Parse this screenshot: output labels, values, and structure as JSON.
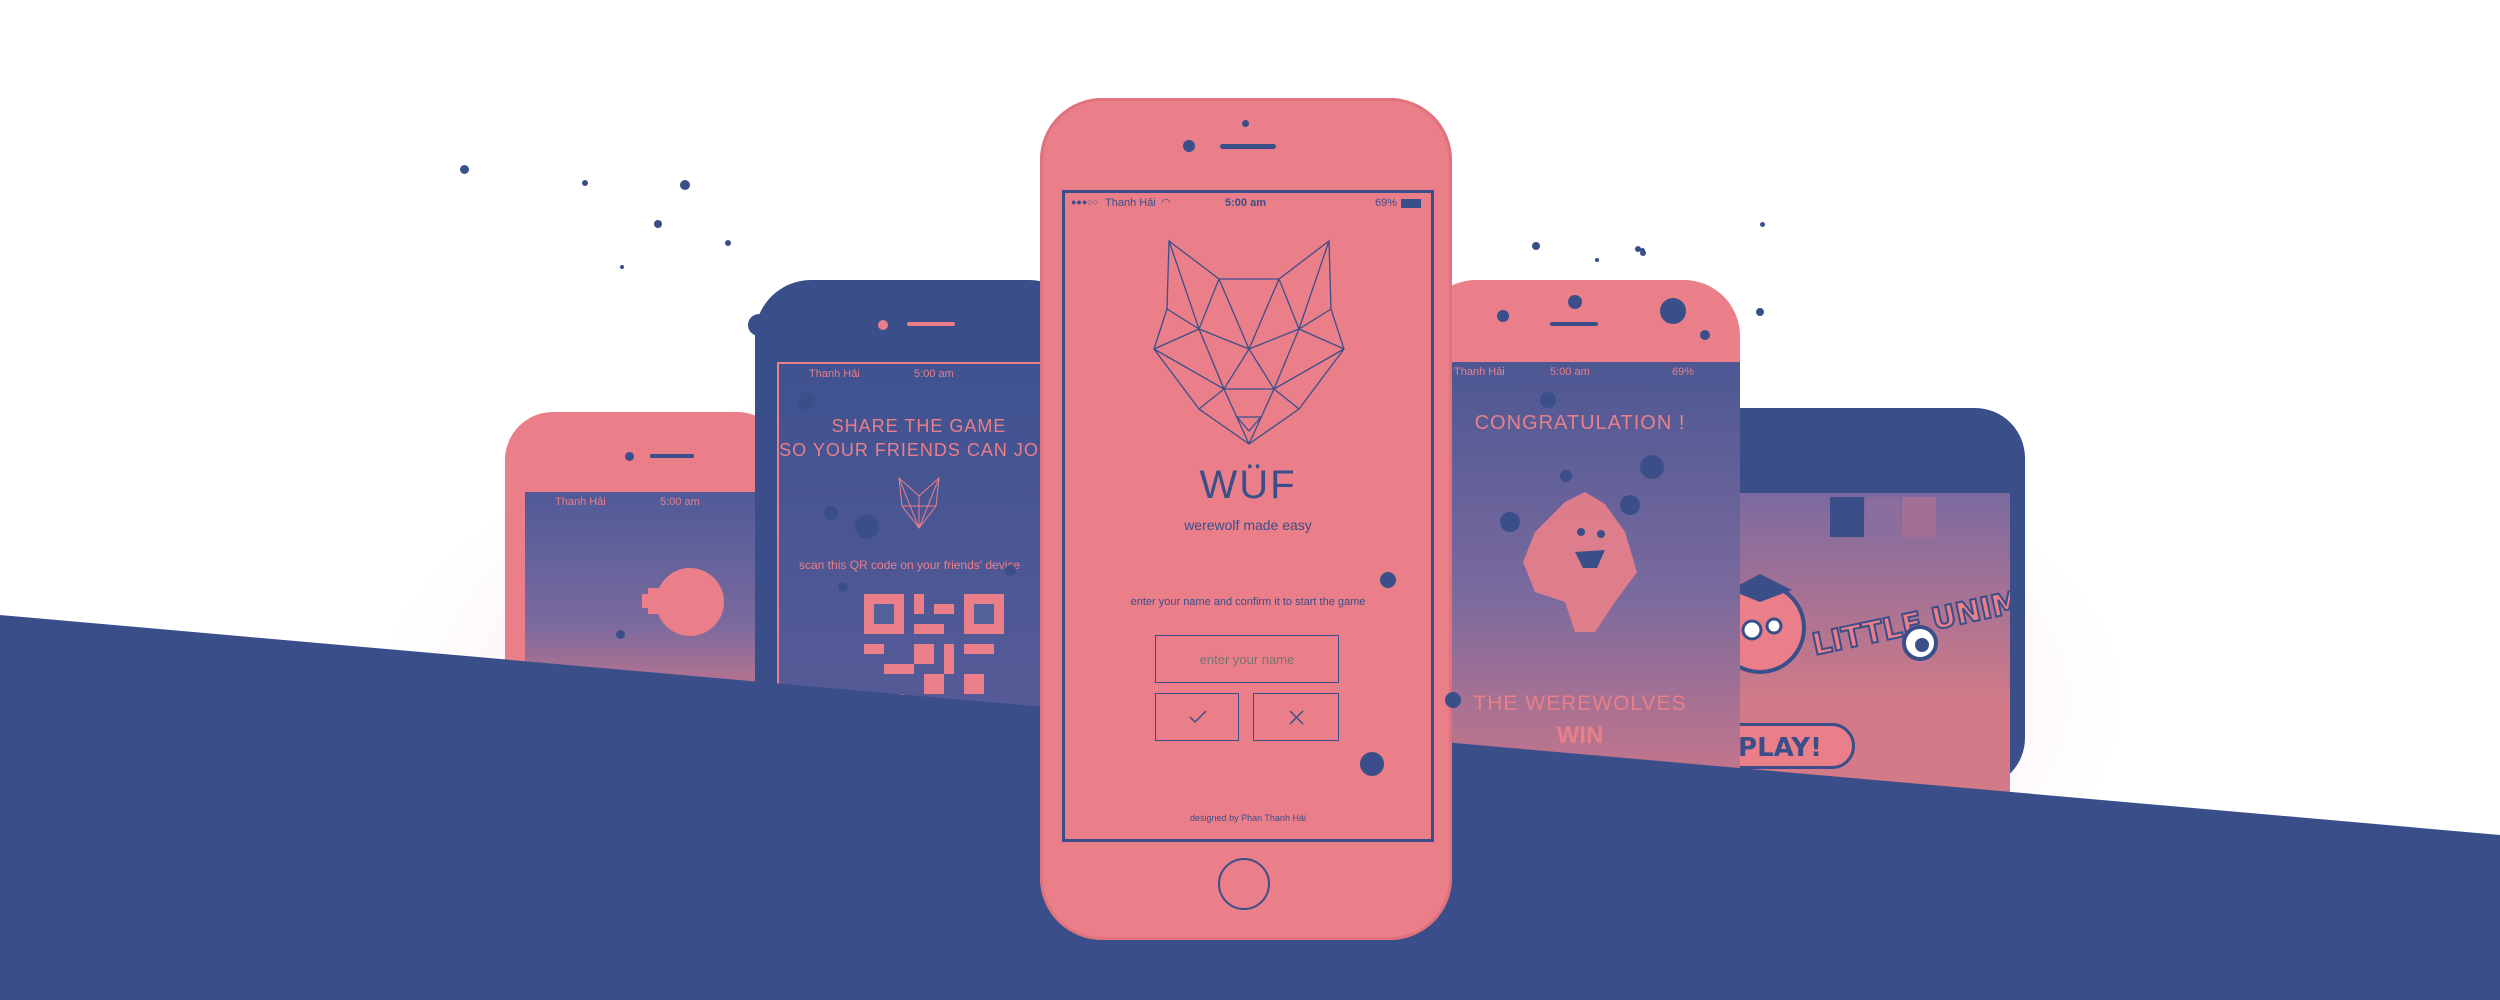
{
  "palette": {
    "navy": "#3a4f8a",
    "coral": "#ea7f89",
    "white": "#ffffff"
  },
  "main_phone": {
    "status": {
      "carrier": "Thanh Hải",
      "time": "5:00 am",
      "battery": "69%"
    },
    "logo_icon": "wolf-geometric-icon",
    "app_name": "WÜF",
    "tagline": "werewolf made easy",
    "instruction": "enter your name and confirm it to start the game",
    "name_input_placeholder": "enter your name",
    "confirm_icon": "checkmark-icon",
    "cancel_icon": "close-icon",
    "footer": "designed by Phan Thanh Hải"
  },
  "share_phone": {
    "status": {
      "carrier": "Thanh Hải",
      "time": "5:00 am"
    },
    "title_line1": "SHARE THE GAME",
    "title_line2": "SO YOUR FRIENDS CAN JOIN",
    "instruction": "scan this QR code on your friends' device"
  },
  "left_phone": {
    "status": {
      "carrier": "Thanh Hải",
      "time": "5:00 am"
    }
  },
  "result_phone": {
    "status": {
      "carrier": "Thanh Hải",
      "time": "5:00 am",
      "battery": "69%"
    },
    "title": "CONGRATULATION !",
    "result_line1": "THE WEREWOLVES",
    "result_line2": "WIN"
  },
  "game_phone": {
    "logo_text": "LITTLE UNIMON",
    "play_label": "PLAY!"
  }
}
